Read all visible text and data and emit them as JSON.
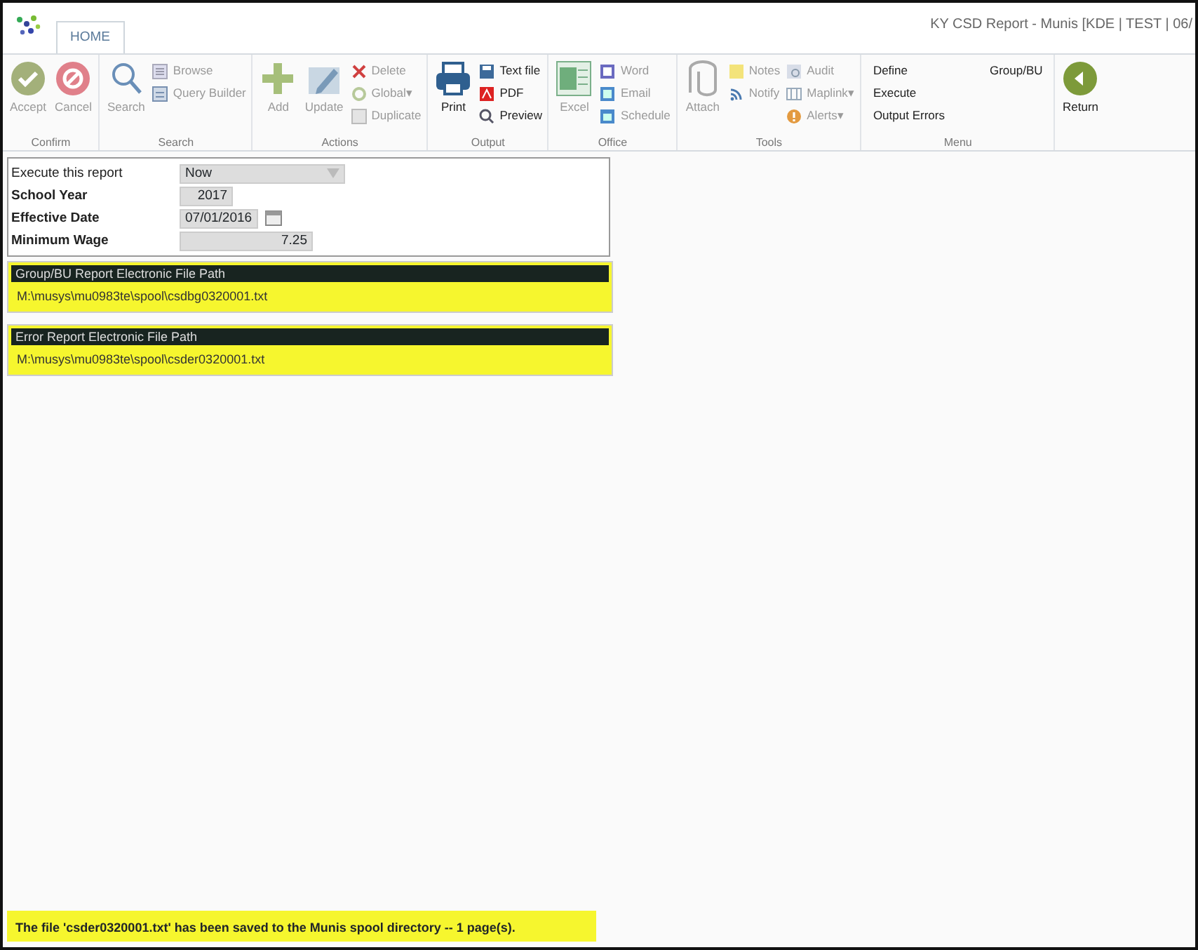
{
  "window": {
    "title": "KY CSD Report - Munis [KDE | TEST | 06/"
  },
  "tabs": [
    {
      "label": "HOME",
      "selected": true
    }
  ],
  "ribbon": [
    {
      "label": "Confirm",
      "columns": [
        {
          "kind": "big",
          "items": [
            {
              "label": "Accept",
              "disabled": true
            }
          ]
        },
        {
          "kind": "big",
          "items": [
            {
              "label": "Cancel",
              "disabled": true
            }
          ]
        }
      ]
    },
    {
      "label": "Search",
      "columns": [
        {
          "kind": "big",
          "items": [
            {
              "label": "Search",
              "disabled": true
            }
          ]
        },
        {
          "kind": "small",
          "items": [
            {
              "label": "Browse",
              "disabled": true
            },
            {
              "label": "Query Builder",
              "disabled": true
            }
          ]
        }
      ]
    },
    {
      "label": "Actions",
      "columns": [
        {
          "kind": "big",
          "items": [
            {
              "label": "Add",
              "disabled": true
            }
          ]
        },
        {
          "kind": "big",
          "items": [
            {
              "label": "Update",
              "disabled": true
            }
          ]
        },
        {
          "kind": "small",
          "items": [
            {
              "label": "Delete",
              "disabled": true
            },
            {
              "label": "Global▾",
              "disabled": true
            },
            {
              "label": "Duplicate",
              "disabled": true
            }
          ]
        }
      ]
    },
    {
      "label": "Output",
      "columns": [
        {
          "kind": "big",
          "items": [
            {
              "label": "Print",
              "disabled": false
            }
          ]
        },
        {
          "kind": "small",
          "items": [
            {
              "label": "Text file",
              "disabled": false
            },
            {
              "label": "PDF",
              "disabled": false
            },
            {
              "label": "Preview",
              "disabled": false
            }
          ]
        }
      ]
    },
    {
      "label": "Office",
      "columns": [
        {
          "kind": "big",
          "items": [
            {
              "label": "Excel",
              "disabled": true
            }
          ]
        },
        {
          "kind": "small",
          "items": [
            {
              "label": "Word",
              "disabled": true
            },
            {
              "label": "Email",
              "disabled": true
            },
            {
              "label": "Schedule",
              "disabled": true
            }
          ]
        }
      ]
    },
    {
      "label": "Tools",
      "columns": [
        {
          "kind": "big",
          "items": [
            {
              "label": "Attach",
              "disabled": true
            }
          ]
        },
        {
          "kind": "small",
          "items": [
            {
              "label": "Notes",
              "disabled": true
            },
            {
              "label": "Notify",
              "disabled": true
            }
          ]
        },
        {
          "kind": "small",
          "items": [
            {
              "label": "Audit",
              "disabled": true
            },
            {
              "label": "Maplink▾",
              "disabled": true
            },
            {
              "label": "Alerts▾",
              "disabled": true
            }
          ]
        }
      ]
    },
    {
      "label": "Menu",
      "columns": [
        {
          "kind": "text",
          "items": [
            {
              "label": "Define",
              "disabled": false
            },
            {
              "label": "Execute",
              "disabled": false
            },
            {
              "label": "Output Errors",
              "disabled": false
            }
          ]
        },
        {
          "kind": "text",
          "items": [
            {
              "label": "Group/BU",
              "disabled": false
            }
          ]
        }
      ]
    },
    {
      "columns": [
        {
          "kind": "big",
          "items": [
            {
              "label": "Return",
              "disabled": false
            }
          ]
        }
      ]
    }
  ],
  "form": [
    {
      "label": "Execute this report",
      "bold": false,
      "kind": "select",
      "value": "Now"
    },
    {
      "label": "School Year",
      "bold": true,
      "kind": "number",
      "value": "2017"
    },
    {
      "label": "Effective Date",
      "bold": true,
      "kind": "date",
      "value": "07/01/2016"
    },
    {
      "label": "Minimum Wage",
      "bold": true,
      "kind": "number",
      "value": "7.25"
    }
  ],
  "paths": [
    {
      "title": "Group/BU Report Electronic File Path",
      "value": "M:\\musys\\mu0983te\\spool\\csdbg0320001.txt"
    },
    {
      "title": "Error Report Electronic File Path",
      "value": "M:\\musys\\mu0983te\\spool\\csder0320001.txt"
    }
  ],
  "status_bar": {
    "message": "The file 'csder0320001.txt' has been saved to the Munis spool directory -- 1 page(s)."
  }
}
